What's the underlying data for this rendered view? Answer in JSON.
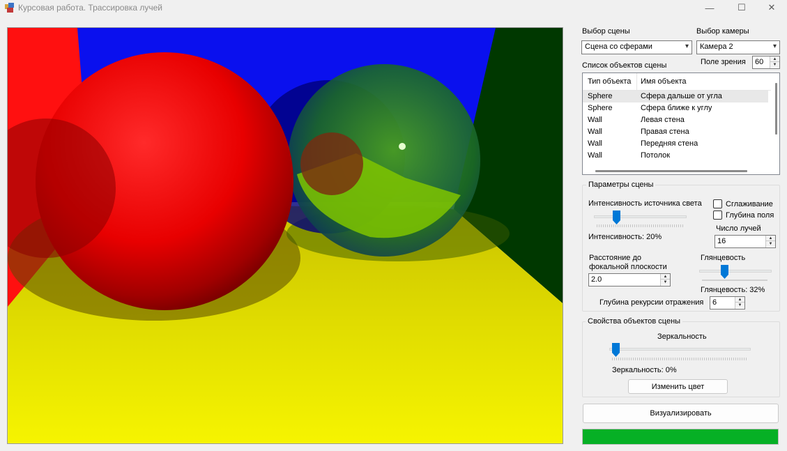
{
  "window": {
    "title": "Курсовая работа. Трассировка лучей",
    "controls": [
      "—",
      "☐",
      "✕"
    ]
  },
  "scene_select": {
    "label": "Выбор сцены",
    "value": "Сцена со сферами"
  },
  "camera_select": {
    "label": "Выбор камеры",
    "value": "Камера 2"
  },
  "fov": {
    "label": "Поле зрения",
    "value": "60"
  },
  "objects_list": {
    "label": "Список объектов сцены",
    "columns": [
      "Тип объекта",
      "Имя объекта"
    ],
    "rows": [
      {
        "type": "Sphere",
        "name": "Сфера дальше от угла"
      },
      {
        "type": "Sphere",
        "name": "Сфера ближе к углу"
      },
      {
        "type": "Wall",
        "name": "Левая стена"
      },
      {
        "type": "Wall",
        "name": "Правая стена"
      },
      {
        "type": "Wall",
        "name": "Передняя стена"
      },
      {
        "type": "Wall",
        "name": "Потолок"
      }
    ]
  },
  "scene_params": {
    "title": "Параметры сцены",
    "light_label": "Интенсивность источника света",
    "light_value_text": "Интенсивность: 20%",
    "light_level": 0.2,
    "antialiasing": "Сглаживание",
    "depth_of_field": "Глубина поля",
    "rays_label": "Число лучей",
    "rays_value": "16",
    "focal_label_1": "Расстояние до",
    "focal_label_2": "фокальной плоскости",
    "focal_value": "2.0",
    "gloss_label": "Глянцевость",
    "gloss_value_text": "Глянцевость: 32%",
    "gloss_level": 0.32,
    "recursion_label": "Глубина рекурсии отражения",
    "recursion_value": "6"
  },
  "object_props": {
    "title": "Свойства объектов сцены",
    "specular_label": "Зеркальность",
    "specular_value_text": "Зеркальность: 0%",
    "specular_level": 0,
    "color_button": "Изменить цвет"
  },
  "render_button": "Визуализировать",
  "progress": 1.0,
  "colors": {
    "accent": "#0078d7",
    "progress": "#06b025",
    "ceiling": "#0a10ee",
    "floor": "#eff000",
    "left_wall": "#ff1010",
    "right_wall": "#003800"
  }
}
